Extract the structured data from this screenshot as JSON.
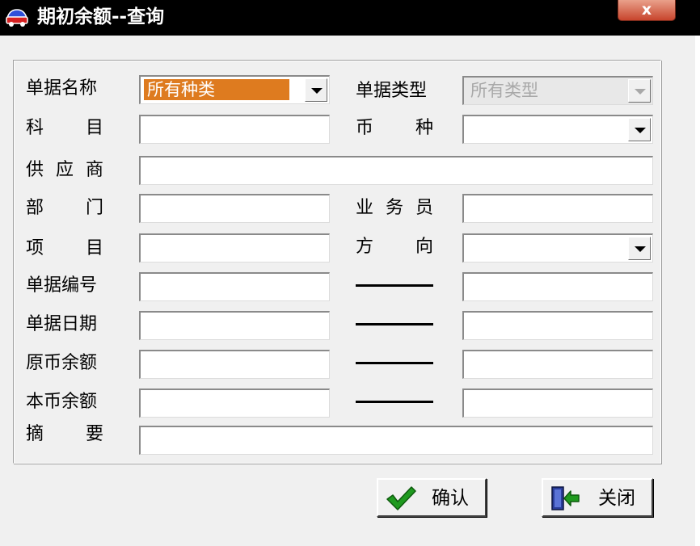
{
  "window": {
    "title": "期初余额--查询",
    "close_label": "x",
    "app_icon": "car-app-icon"
  },
  "form": {
    "labels": {
      "doc_name": "单据名称",
      "doc_type": "单据类型",
      "subject": [
        "科",
        "目"
      ],
      "currency": [
        "币",
        "种"
      ],
      "supplier": [
        "供",
        "应",
        "商"
      ],
      "department": [
        "部",
        "门"
      ],
      "salesperson": [
        "业",
        "务",
        "员"
      ],
      "project": [
        "项",
        "目"
      ],
      "direction": [
        "方",
        "向"
      ],
      "doc_number": "单据编号",
      "doc_date": "单据日期",
      "orig_balance": "原币余额",
      "local_balance": "本币余额",
      "summary": [
        "摘",
        "要"
      ]
    },
    "doc_name_value": "所有种类",
    "doc_type_value": "所有类型"
  },
  "buttons": {
    "confirm": "确认",
    "close": "关闭"
  },
  "colors": {
    "titlebar": "#000000",
    "selection": "#de7b1f",
    "dialog_bg": "#f0f0f0",
    "confirm_icon": "#1f9a1f"
  },
  "icons": [
    "checkmark-icon",
    "exit-door-icon",
    "dropdown-arrow-icon"
  ]
}
